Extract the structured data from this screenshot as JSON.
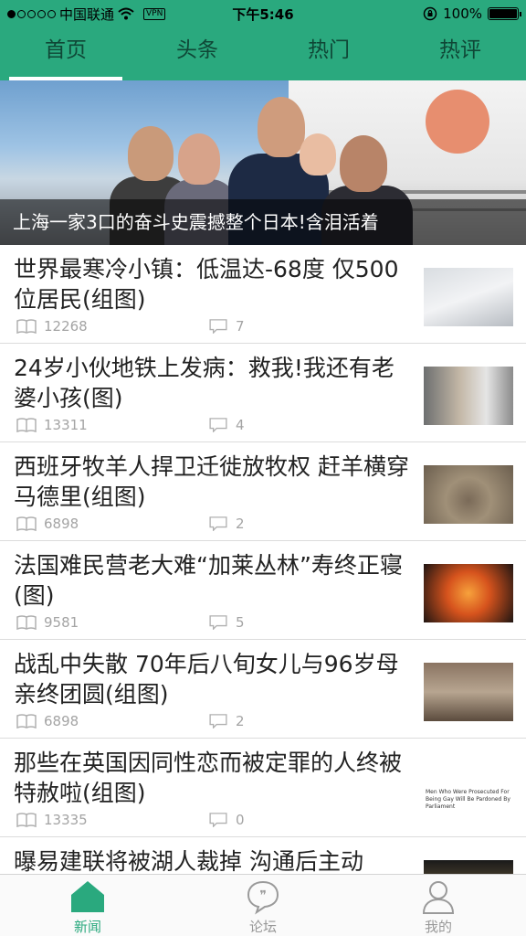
{
  "status_bar": {
    "carrier": "中国联通",
    "vpn": "VPN",
    "time": "下午5:46",
    "battery": "100%",
    "battery_level": 1.0
  },
  "top_tabs": [
    {
      "label": "首页",
      "active": true
    },
    {
      "label": "头条",
      "active": false
    },
    {
      "label": "热门",
      "active": false
    },
    {
      "label": "热评",
      "active": false
    }
  ],
  "hero": {
    "caption": "上海一家3口的奋斗史震撼整个日本!含泪活着"
  },
  "news": [
    {
      "title": "世界最寒冷小镇：低温达-68度 仅500位居民(组图)",
      "views": "12268",
      "comments": "7"
    },
    {
      "title": "24岁小伙地铁上发病：救我!我还有老婆小孩(图)",
      "views": "13311",
      "comments": "4"
    },
    {
      "title": "西班牙牧羊人捍卫迁徙放牧权 赶羊横穿马德里(组图)",
      "views": "6898",
      "comments": "2"
    },
    {
      "title": "法国难民营老大难“加莱丛林”寿终正寝(图)",
      "views": "9581",
      "comments": "5"
    },
    {
      "title": "战乱中失散 70年后八旬女儿与96岁母亲终团圆(组图)",
      "views": "6898",
      "comments": "2"
    },
    {
      "title": "那些在英国因同性恋而被定罪的人终被特赦啦(组图)",
      "views": "13335",
      "comments": "0",
      "thumb_text": "Men Who Were Prosecuted For Being Gay Will Be Pardoned By Parliament"
    },
    {
      "title": "曝易建联将被湖人裁掉 沟通后主动"
    }
  ],
  "bottom_nav": [
    {
      "label": "新闻",
      "icon": "home-icon",
      "active": true
    },
    {
      "label": "论坛",
      "icon": "chat-bubble-icon",
      "active": false
    },
    {
      "label": "我的",
      "icon": "person-icon",
      "active": false
    }
  ],
  "colors": {
    "accent": "#2aa97e",
    "tab_text": "#0f4736",
    "meta_text": "#a4a4a4"
  }
}
